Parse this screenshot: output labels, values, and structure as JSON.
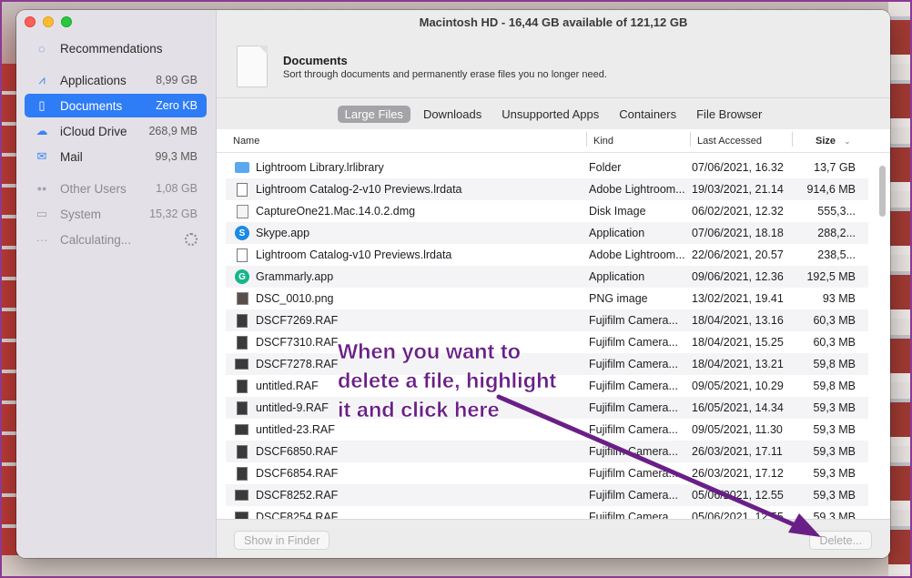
{
  "window": {
    "title": "Macintosh HD - 16,44 GB available of 121,12 GB"
  },
  "sidebar": {
    "items": [
      {
        "icon": "lightbulb-icon",
        "glyph": "◌",
        "label": "Recommendations",
        "value": ""
      },
      {
        "icon": "applications-icon",
        "glyph": "⩘",
        "label": "Applications",
        "value": "8,99 GB"
      },
      {
        "icon": "document-icon",
        "glyph": "▯",
        "label": "Documents",
        "value": "Zero KB"
      },
      {
        "icon": "cloud-icon",
        "glyph": "☁",
        "label": "iCloud Drive",
        "value": "268,9 MB"
      },
      {
        "icon": "mail-icon",
        "glyph": "✉",
        "label": "Mail",
        "value": "99,3 MB"
      },
      {
        "icon": "users-icon",
        "glyph": "●●",
        "label": "Other Users",
        "value": "1,08 GB"
      },
      {
        "icon": "laptop-icon",
        "glyph": "▭",
        "label": "System",
        "value": "15,32 GB"
      },
      {
        "icon": "ellipsis-icon",
        "glyph": "···",
        "label": "Calculating...",
        "value": ""
      }
    ]
  },
  "header": {
    "title": "Documents",
    "subtitle": "Sort through documents and permanently erase files you no longer need."
  },
  "tabs": [
    "Large Files",
    "Downloads",
    "Unsupported Apps",
    "Containers",
    "File Browser"
  ],
  "table": {
    "columns": [
      "Name",
      "Kind",
      "Last Accessed",
      "Size"
    ],
    "rows": [
      {
        "icon": "folder",
        "name": "Lightroom Library.lrlibrary",
        "kind": "Folder",
        "date": "07/06/2021, 16.32",
        "size": "13,7 GB"
      },
      {
        "icon": "doc",
        "name": "Lightroom Catalog-2-v10 Previews.lrdata",
        "kind": "Adobe Lightroom...",
        "date": "19/03/2021, 21.14",
        "size": "914,6 MB"
      },
      {
        "icon": "dmg",
        "name": "CaptureOne21.Mac.14.0.2.dmg",
        "kind": "Disk Image",
        "date": "06/02/2021, 12.32",
        "size": "555,3..."
      },
      {
        "icon": "skype",
        "name": "Skype.app",
        "kind": "Application",
        "date": "07/06/2021, 18.18",
        "size": "288,2..."
      },
      {
        "icon": "doc",
        "name": "Lightroom Catalog-v10 Previews.lrdata",
        "kind": "Adobe Lightroom...",
        "date": "22/06/2021, 20.57",
        "size": "238,5..."
      },
      {
        "icon": "grammarly",
        "name": "Grammarly.app",
        "kind": "Application",
        "date": "09/06/2021, 12.36",
        "size": "192,5 MB"
      },
      {
        "icon": "png",
        "name": "DSC_0010.png",
        "kind": "PNG image",
        "date": "13/02/2021, 19.41",
        "size": "93 MB"
      },
      {
        "icon": "raf",
        "name": "DSCF7269.RAF",
        "kind": "Fujifilm Camera...",
        "date": "18/04/2021, 13.16",
        "size": "60,3 MB"
      },
      {
        "icon": "raf",
        "name": "DSCF7310.RAF",
        "kind": "Fujifilm Camera...",
        "date": "18/04/2021, 15.25",
        "size": "60,3 MB"
      },
      {
        "icon": "raf-w",
        "name": "DSCF7278.RAF",
        "kind": "Fujifilm Camera...",
        "date": "18/04/2021, 13.21",
        "size": "59,8 MB"
      },
      {
        "icon": "raf",
        "name": "untitled.RAF",
        "kind": "Fujifilm Camera...",
        "date": "09/05/2021, 10.29",
        "size": "59,8 MB"
      },
      {
        "icon": "raf",
        "name": "untitled-9.RAF",
        "kind": "Fujifilm Camera...",
        "date": "16/05/2021, 14.34",
        "size": "59,3 MB"
      },
      {
        "icon": "raf-w",
        "name": "untitled-23.RAF",
        "kind": "Fujifilm Camera...",
        "date": "09/05/2021, 11.30",
        "size": "59,3 MB"
      },
      {
        "icon": "raf",
        "name": "DSCF6850.RAF",
        "kind": "Fujifilm Camera...",
        "date": "26/03/2021, 17.11",
        "size": "59,3 MB"
      },
      {
        "icon": "raf",
        "name": "DSCF6854.RAF",
        "kind": "Fujifilm Camera...",
        "date": "26/03/2021, 17.12",
        "size": "59,3 MB"
      },
      {
        "icon": "raf-w",
        "name": "DSCF8252.RAF",
        "kind": "Fujifilm Camera...",
        "date": "05/06/2021, 12.55",
        "size": "59,3 MB"
      },
      {
        "icon": "raf-w",
        "name": "DSCF8254.RAF",
        "kind": "Fujifilm Camera...",
        "date": "05/06/2021, 12.55",
        "size": "59,3 MB"
      }
    ]
  },
  "footer": {
    "show_in_finder": "Show in Finder",
    "delete": "Delete..."
  },
  "annotation": {
    "lines": [
      "When you want to",
      "delete a file, highlight",
      "it and click here"
    ],
    "color": "#6a1f87"
  }
}
